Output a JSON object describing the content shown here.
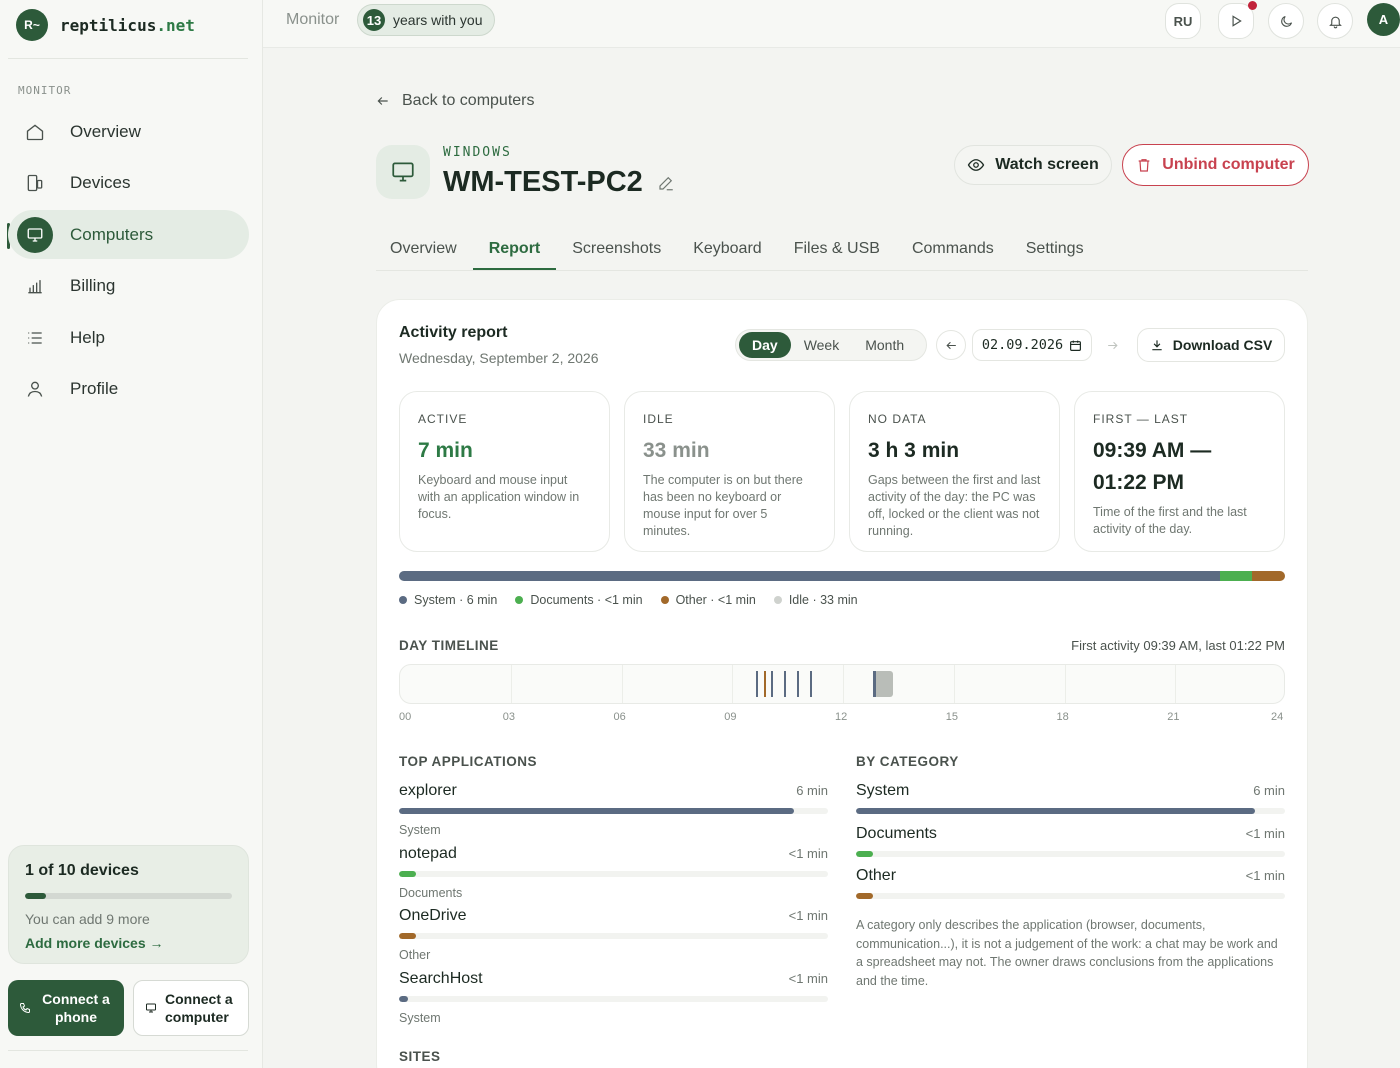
{
  "brand": {
    "badge": "R~",
    "name": "reptilicus",
    "tld": ".net"
  },
  "sidebar": {
    "section": "MONITOR",
    "items": [
      {
        "label": "Overview",
        "icon": "home-icon"
      },
      {
        "label": "Devices",
        "icon": "devices-icon"
      },
      {
        "label": "Computers",
        "icon": "monitor-icon",
        "active": true
      },
      {
        "label": "Billing",
        "icon": "chart-icon"
      },
      {
        "label": "Help",
        "icon": "list-icon"
      },
      {
        "label": "Profile",
        "icon": "user-icon"
      }
    ],
    "devices_card": {
      "title": "1 of 10 devices",
      "used": 1,
      "total": 10,
      "subtitle": "You can add 9 more",
      "link": "Add more devices →"
    },
    "connect_phone": "Connect a phone",
    "connect_computer": "Connect a computer"
  },
  "topbar": {
    "crumb": "Monitor",
    "years_number": "13",
    "years_text": "years with you",
    "lang": "RU",
    "avatar": "A"
  },
  "main": {
    "back_label": "Back to computers",
    "os_label": "WINDOWS",
    "computer_name": "WM-TEST-PC2",
    "watch_label": "Watch screen",
    "unbind_label": "Unbind computer",
    "tabs": [
      "Overview",
      "Report",
      "Screenshots",
      "Keyboard",
      "Files & USB",
      "Commands",
      "Settings"
    ],
    "active_tab": "Report"
  },
  "report": {
    "title": "Activity report",
    "date_long": "Wednesday, September 2, 2026",
    "periods": [
      "Day",
      "Week",
      "Month"
    ],
    "active_period": "Day",
    "date_value": "02.09.2026",
    "csv_label": "Download CSV",
    "stats": [
      {
        "label": "ACTIVE",
        "value": "7 min",
        "desc": "Keyboard and mouse input with an application window in focus."
      },
      {
        "label": "IDLE",
        "value": "33 min",
        "desc": "The computer is on but there has been no keyboard or mouse input for over 5 minutes."
      },
      {
        "label": "NO DATA",
        "value": "3 h 3 min",
        "desc": "Gaps between the first and last activity of the day: the PC was off, locked or the client was not running."
      },
      {
        "label": "FIRST — LAST",
        "value": "09:39 AM —",
        "value2": "01:22 PM",
        "desc": "Time of the first and the last activity of the day."
      }
    ],
    "usage": [
      {
        "label": "System · 6 min",
        "color": "#5b6b82",
        "share": 0.927
      },
      {
        "label": "Documents · <1 min",
        "color": "#4caf50",
        "share": 0.036
      },
      {
        "label": "Other · <1 min",
        "color": "#a2692a",
        "share": 0.037
      },
      {
        "label": "Idle · 33 min",
        "color": "#cfd2ce",
        "share": 0
      }
    ],
    "timeline": {
      "title": "DAY TIMELINE",
      "note": "First activity 09:39 AM, last 01:22 PM",
      "ticks": [
        "00",
        "03",
        "06",
        "09",
        "12",
        "15",
        "18",
        "21",
        "24"
      ],
      "marks": [
        {
          "hour": 9.65,
          "color": "#5b6b82"
        },
        {
          "hour": 9.85,
          "color": "#a2692a"
        },
        {
          "hour": 10.05,
          "color": "#5b6b82"
        },
        {
          "hour": 10.4,
          "color": "#5b6b82"
        },
        {
          "hour": 10.75,
          "color": "#5b6b82"
        },
        {
          "hour": 11.1,
          "color": "#5b6b82"
        }
      ],
      "idle_block": {
        "start": 12.85,
        "end": 13.35,
        "color": "#b9bdb8"
      },
      "idle_edge": {
        "hour": 12.8,
        "color": "#5b6b82"
      }
    },
    "top_apps": {
      "title": "TOP APPLICATIONS",
      "items": [
        {
          "name": "explorer",
          "time": "6 min",
          "category": "System",
          "share": 0.92,
          "color": "#5b6b82"
        },
        {
          "name": "notepad",
          "time": "<1 min",
          "category": "Documents",
          "share": 0.04,
          "color": "#4caf50"
        },
        {
          "name": "OneDrive",
          "time": "<1 min",
          "category": "Other",
          "share": 0.04,
          "color": "#a2692a"
        },
        {
          "name": "SearchHost",
          "time": "<1 min",
          "category": "System",
          "share": 0.02,
          "color": "#5b6b82"
        }
      ]
    },
    "by_category": {
      "title": "BY CATEGORY",
      "items": [
        {
          "name": "System",
          "time": "6 min",
          "share": 0.93,
          "color": "#5b6b82"
        },
        {
          "name": "Documents",
          "time": "<1 min",
          "share": 0.04,
          "color": "#4caf50"
        },
        {
          "name": "Other",
          "time": "<1 min",
          "share": 0.04,
          "color": "#a2692a"
        }
      ],
      "note": "A category only describes the application (browser, documents, communication...), it is not a judgement of the work: a chat may be work and a spreadsheet may not. The owner draws conclusions from the applications and the time."
    },
    "sites_title": "SITES"
  }
}
